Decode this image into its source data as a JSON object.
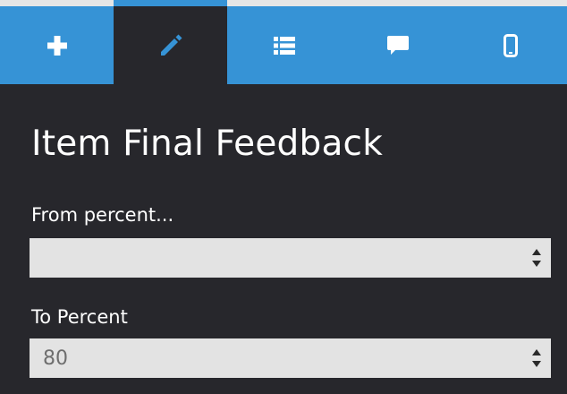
{
  "colors": {
    "toolbar_blue": "#3693d6",
    "panel_dark": "#27272c",
    "field_bg": "#e3e3e3",
    "text_white": "#ffffff"
  },
  "toolbar": {
    "tabs": [
      {
        "icon": "plus-icon",
        "active": false
      },
      {
        "icon": "pencil-icon",
        "active": true
      },
      {
        "icon": "list-icon",
        "active": false
      },
      {
        "icon": "speech-bubble-icon",
        "active": false
      },
      {
        "icon": "mobile-phone-icon",
        "active": false
      }
    ]
  },
  "panel": {
    "title": "Item Final Feedback",
    "from_percent": {
      "label": "From percent...",
      "value": ""
    },
    "to_percent": {
      "label": "To Percent",
      "value": "80"
    }
  }
}
